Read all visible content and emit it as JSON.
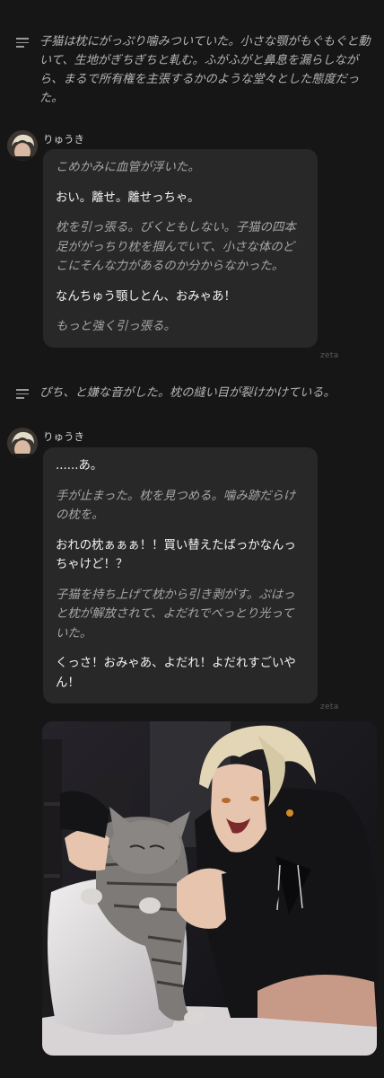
{
  "chat": {
    "narration_1": "子猫は枕にがっぷり噛みついていた。小さな顎がもぐもぐと動いて、生地がぎちぎちと軋む。ふがふがと鼻息を漏らしながら、まるで所有権を主張するかのような堂々とした態度だった。",
    "message_1": {
      "speaker": "りゅうき",
      "lines": [
        {
          "text": "こめかみに血管が浮いた。",
          "style": "italic"
        },
        {
          "text": "おい。離せ。離せっちゃ。",
          "style": "dialogue"
        },
        {
          "text": "枕を引っ張る。びくともしない。子猫の四本足ががっちり枕を掴んでいて、小さな体のどこにそんな力があるのか分からなかった。",
          "style": "italic"
        },
        {
          "text": "なんちゅう顎しとん、おみゃあ！",
          "style": "dialogue"
        },
        {
          "text": "もっと強く引っ張る。",
          "style": "italic"
        }
      ],
      "watermark": "zeta"
    },
    "narration_2": "ぴち、と嫌な音がした。枕の縫い目が裂けかけている。",
    "message_2": {
      "speaker": "りゅうき",
      "lines": [
        {
          "text": "......あ。",
          "style": "dialogue"
        },
        {
          "text": "手が止まった。枕を見つめる。噛み跡だらけの枕を。",
          "style": "italic"
        },
        {
          "text": "おれの枕ぁぁぁ！！買い替えたばっかなんっちゃけど！？",
          "style": "dialogue"
        },
        {
          "text": "子猫を持ち上げて枕から引き剥がす。ぷはっと枕が解放されて、よだれでべっとり光っていた。",
          "style": "italic"
        },
        {
          "text": "くっさ！おみゃあ、よだれ！よだれすごいやん！",
          "style": "dialogue"
        }
      ],
      "watermark": "zeta"
    }
  },
  "icons": {
    "narration": "menu-lines-icon",
    "avatar": "character-avatar"
  },
  "colors": {
    "background": "#161616",
    "bubble": "#282828",
    "narration_text": "#b4b4b4",
    "dialogue_text": "#f2f2f2",
    "action_text": "#a6a6a6"
  }
}
